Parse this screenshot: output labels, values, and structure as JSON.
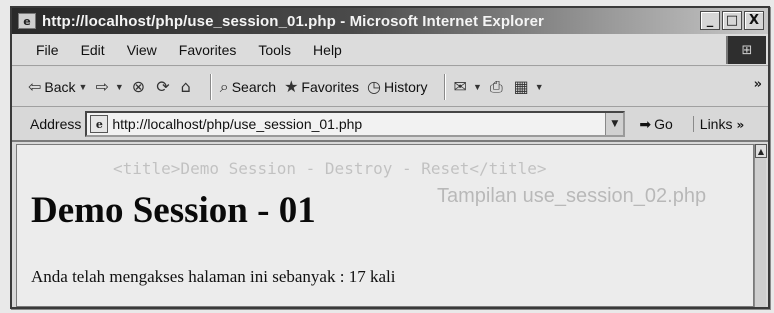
{
  "window": {
    "title": "http://localhost/php/use_session_01.php - Microsoft Internet Explorer",
    "controls": {
      "minimize": "_",
      "maximize": "□",
      "close": "X"
    }
  },
  "menubar": {
    "items": [
      {
        "label": "File"
      },
      {
        "label": "Edit"
      },
      {
        "label": "View"
      },
      {
        "label": "Favorites"
      },
      {
        "label": "Tools"
      },
      {
        "label": "Help"
      }
    ]
  },
  "toolbar": {
    "back_label": "Back",
    "search_label": "Search",
    "favorites_label": "Favorites",
    "history_label": "History",
    "more": "»",
    "icons": [
      "back-arrow-icon",
      "forward-arrow-icon",
      "stop-icon",
      "refresh-icon",
      "home-icon",
      "search-icon",
      "favorites-icon",
      "history-icon",
      "mail-icon",
      "print-icon",
      "edit-icon"
    ]
  },
  "addressbar": {
    "label": "Address",
    "url": "http://localhost/php/use_session_01.php",
    "go_label": "Go",
    "links_label": "Links",
    "links_more": "»"
  },
  "page": {
    "heading": "Demo Session - 01",
    "text": "Anda telah mengakses halaman ini sebanyak : 17 kali"
  }
}
